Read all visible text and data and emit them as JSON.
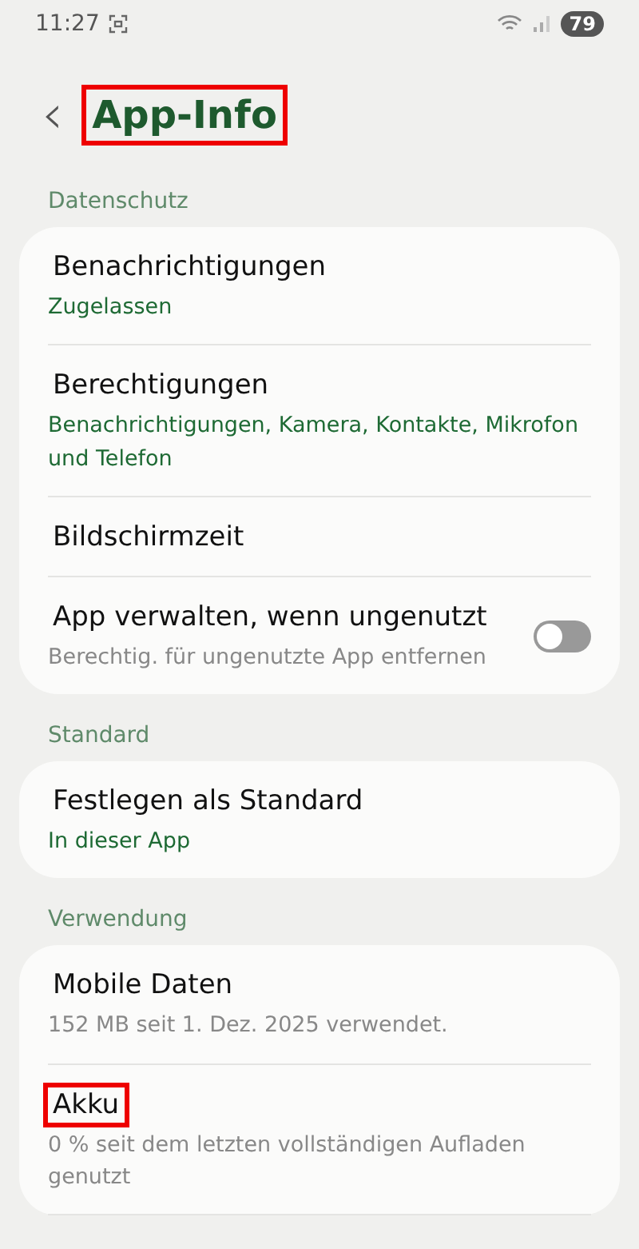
{
  "status_bar": {
    "time": "11:27",
    "battery": "79"
  },
  "header": {
    "back": "‹",
    "title": "App-Info",
    "highlighted": true
  },
  "sections": [
    {
      "heading": "Datenschutz",
      "items": [
        {
          "title": "Benachrichtigungen",
          "highlighted": false,
          "subtitle": "Zugelassen",
          "color": "#1e6a34"
        },
        {
          "title": "Berechtigungen",
          "highlighted": false,
          "subtitle": "Benachrichtigungen, Kamera, Kontakte, Mikrofon und Telefon",
          "color": "#1e6a34"
        },
        {
          "title": "Bildschirmzeit",
          "highlighted": false
        },
        {
          "title": "App verwalten, wenn ungenutzt",
          "highlighted": false,
          "subtitle": "Berechtig. für ungenutzte App entfernen",
          "color": "#888888",
          "toggle": {
            "on": false
          }
        }
      ]
    },
    {
      "heading": "Standard",
      "items": [
        {
          "title": "Festlegen als Standard",
          "highlighted": false,
          "subtitle": "In dieser App",
          "color": "#1e6a34"
        }
      ]
    },
    {
      "heading": "Verwendung",
      "items": [
        {
          "title": "Mobile Daten",
          "highlighted": false,
          "subtitle": "152 MB seit 1. Dez. 2025 verwendet.",
          "color": "#888888"
        },
        {
          "title": "Akku",
          "highlighted": true,
          "subtitle": "0 % seit dem letzten vollständigen Aufladen genutzt",
          "color": "#888888"
        }
      ]
    }
  ]
}
